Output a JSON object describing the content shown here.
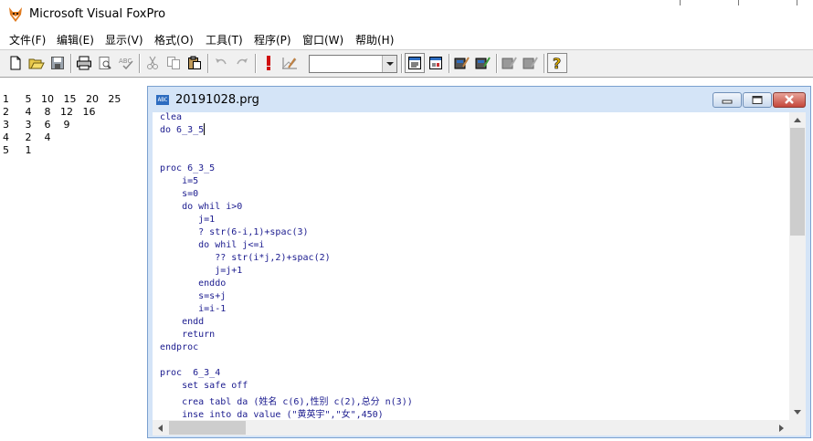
{
  "app": {
    "title": "Microsoft Visual FoxPro"
  },
  "menu": [
    {
      "label": "文件(F)"
    },
    {
      "label": "编辑(E)"
    },
    {
      "label": "显示(V)"
    },
    {
      "label": "格式(O)"
    },
    {
      "label": "工具(T)"
    },
    {
      "label": "程序(P)"
    },
    {
      "label": "窗口(W)"
    },
    {
      "label": "帮助(H)"
    }
  ],
  "toolbar": {
    "buttons": [
      "new-icon",
      "open-icon",
      "save-icon",
      "print-icon",
      "print-preview-icon",
      "spell-check-icon",
      "cut-icon",
      "copy-icon",
      "paste-icon",
      "undo-icon",
      "redo-icon",
      "run-icon",
      "modify-form-icon",
      "command-window-icon",
      "data-session-icon",
      "form-designer-icon",
      "report-designer-icon",
      "expression-builder-icon",
      "code-window-icon",
      "help-icon"
    ],
    "combo_value": ""
  },
  "output": {
    "lines": [
      "1     5   10   15   20   25",
      "2     4    8   12   16",
      "3     3    6    9",
      "4     2    4",
      "5     1"
    ]
  },
  "editor": {
    "title": "20191028.prg",
    "code": [
      "clea",
      "do 6_3_5",
      "",
      "",
      "proc 6_3_5",
      "    i=5",
      "    s=0",
      "    do whil i>0",
      "       j=1",
      "       ? str(6-i,1)+spac(3)",
      "       do whil j<=i",
      "          ?? str(i*j,2)+spac(2)",
      "          j=j+1",
      "       enddo",
      "       s=s+j",
      "       i=i-1",
      "    endd",
      "    return",
      "endproc",
      "",
      "proc  6_3_4",
      "    set safe off",
      "    crea tabl da (姓名 c(6),性别 c(2),总分 n(3))",
      "    inse into da value (\"黄英宇\",\"女\",450)"
    ]
  }
}
